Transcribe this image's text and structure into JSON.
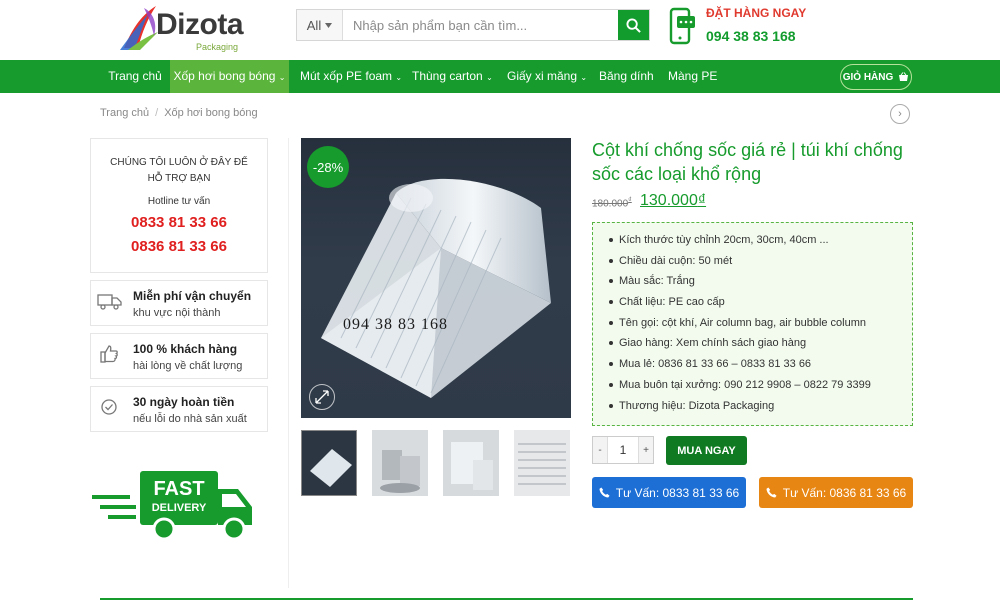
{
  "header": {
    "logo_text": "Dizota",
    "logo_sub": "Packaging",
    "search": {
      "category": "All",
      "placeholder": "Nhập sản phẩm bạn cần tìm..."
    },
    "order": {
      "title": "ĐẶT HÀNG NGAY",
      "phone": "094 38 83 168"
    }
  },
  "nav": {
    "items": [
      {
        "label": "Trang chủ"
      },
      {
        "label": "Xốp hơi bong bóng"
      },
      {
        "label": "Mút xốp PE foam"
      },
      {
        "label": "Thùng carton"
      },
      {
        "label": "Giấy xi măng"
      },
      {
        "label": "Băng dính"
      },
      {
        "label": "Màng PE"
      }
    ],
    "cart": "GIỎ HÀNG"
  },
  "breadcrumb": {
    "home": "Trang chủ",
    "sep": "/",
    "current": "Xốp hơi bong bóng"
  },
  "sidebar": {
    "support_title": "CHÚNG TÔI LUÔN Ở ĐÂY ĐỂ HỖ TRỢ BẠN",
    "hotline_label": "Hotline tư vấn",
    "phone1": "0833 81 33 66",
    "phone2": "0836 81 33 66",
    "features": [
      {
        "icon": "truck-icon",
        "title": "Miễn phí vận chuyển",
        "sub": "khu vực nội thành"
      },
      {
        "icon": "thumbs-up-icon",
        "title": "100 % khách hàng",
        "sub": "hài lòng về chất lượng"
      },
      {
        "icon": "check-circle-icon",
        "title": "30 ngày hoàn tiền",
        "sub": "nếu lỗi do nhà sản xuất"
      }
    ],
    "fast_delivery": {
      "line1": "FAST",
      "line2": "DELIVERY"
    }
  },
  "product": {
    "sale_badge": "-28%",
    "image_watermark": "094 38 83 168",
    "title": "Cột khí chống sốc giá rẻ | túi khí chống sốc các loại khổ rộng",
    "old_price": "180.000",
    "old_currency": "₫",
    "new_price": "130.000",
    "new_currency": "₫",
    "specs": [
      "Kích thước tùy chỉnh 20cm, 30cm, 40cm ...",
      "Chiều dài cuộn: 50 mét",
      "Màu sắc: Trắng",
      "Chất liệu: PE cao cấp",
      "Tên gọi: cột khí, Air column bag, air bubble column",
      "Giao hàng: Xem chính sách giao hàng",
      "Mua lẻ: 0836 81 33 66 – 0833 81 33 66",
      "Mua buôn tại xưởng: 090 212 9908 – 0822 79 3399",
      "Thương hiệu: Dizota Packaging"
    ],
    "qty": {
      "minus": "-",
      "value": "1",
      "plus": "+"
    },
    "buy_now": "MUA NGAY",
    "call1": "Tư Vấn: 0833 81 33 66",
    "call2": "Tư Vấn: 0836 81 33 66"
  },
  "colors": {
    "brand_green": "#169b2c",
    "nav_active": "#5bb43b",
    "hotline_red": "#e01f1f",
    "call_blue": "#1d6fd6",
    "call_orange": "#e88614"
  }
}
